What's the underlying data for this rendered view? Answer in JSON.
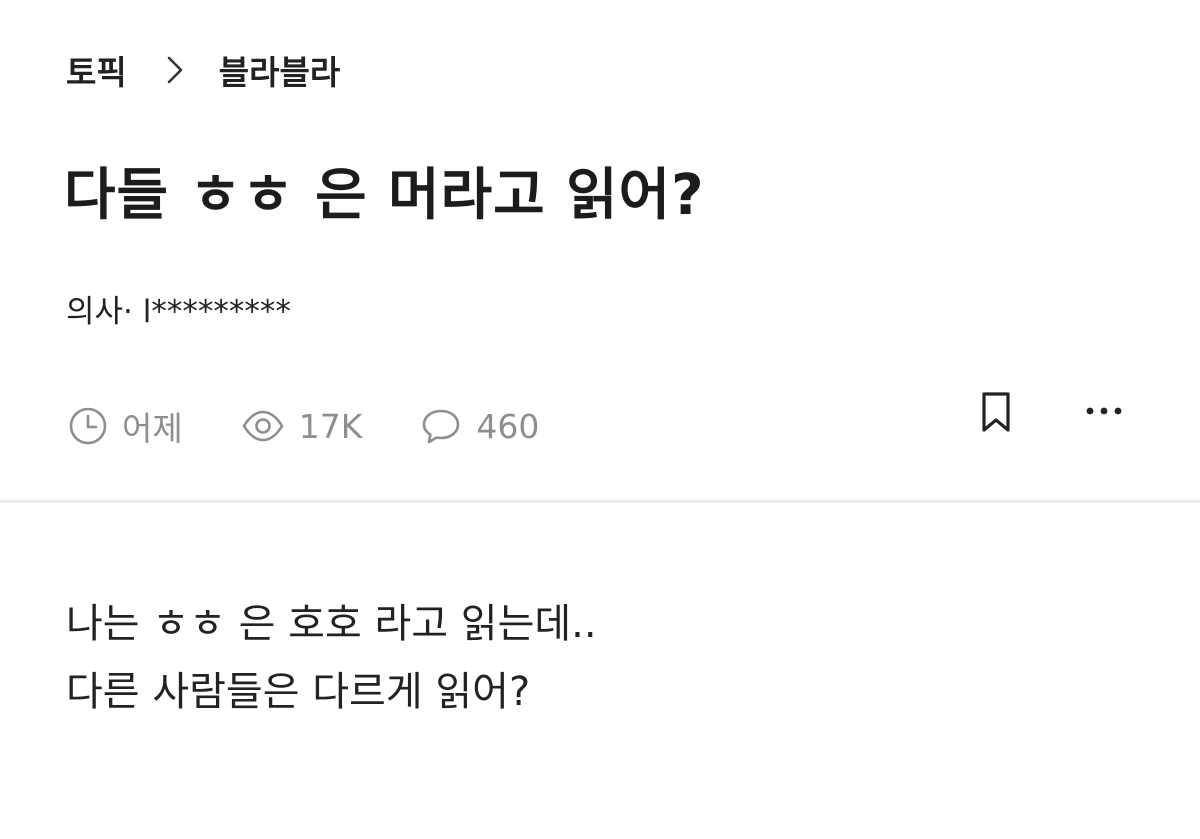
{
  "breadcrumb": {
    "category": "토픽",
    "separator_icon": "chevron-right-icon",
    "board": "블라블라"
  },
  "post": {
    "title": "다들 ㅎㅎ 은 머라고 읽어?",
    "author": "의사· l*********",
    "meta": {
      "time_icon": "clock-icon",
      "time": "어제",
      "views_icon": "eye-icon",
      "views": "17K",
      "comments_icon": "comment-bubble-icon",
      "comments": "460"
    },
    "actions": {
      "bookmark_icon": "bookmark-icon",
      "more_icon": "more-dots-icon"
    },
    "body_lines": [
      "나는 ㅎㅎ 은 호호 라고 읽는데..",
      "다른 사람들은 다르게 읽어?"
    ]
  },
  "colors": {
    "text_primary": "#1c1c1c",
    "text_secondary": "#8e8e8e",
    "divider": "#ececec",
    "background": "#ffffff"
  }
}
